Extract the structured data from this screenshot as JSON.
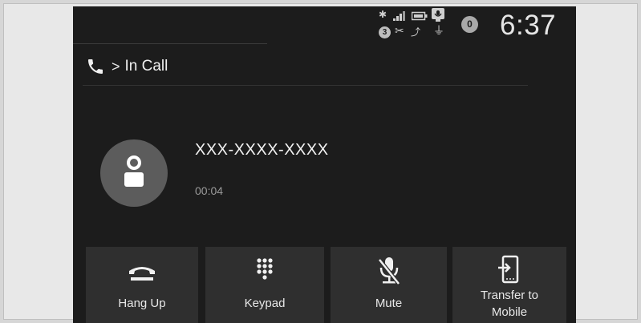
{
  "status_bar": {
    "time": "6:37",
    "notification_count": "0",
    "badge_number": "3",
    "icons": [
      "bluetooth-icon",
      "signal-icon",
      "battery-icon",
      "voice-icon",
      "bluetooth-audio-icon",
      "roaming-icon",
      "usb-icon"
    ]
  },
  "header": {
    "title": "In Call",
    "chevron": ">"
  },
  "call": {
    "number": "XXX-XXXX-XXXX",
    "duration": "00:04"
  },
  "buttons": {
    "hang_up": "Hang Up",
    "keypad": "Keypad",
    "mute": "Mute",
    "transfer_line1": "Transfer to",
    "transfer_line2": "Mobile"
  },
  "colors": {
    "screen_bg": "#1c1c1c",
    "button_bg": "#2f2f2f",
    "text": "#e8e8e8"
  }
}
